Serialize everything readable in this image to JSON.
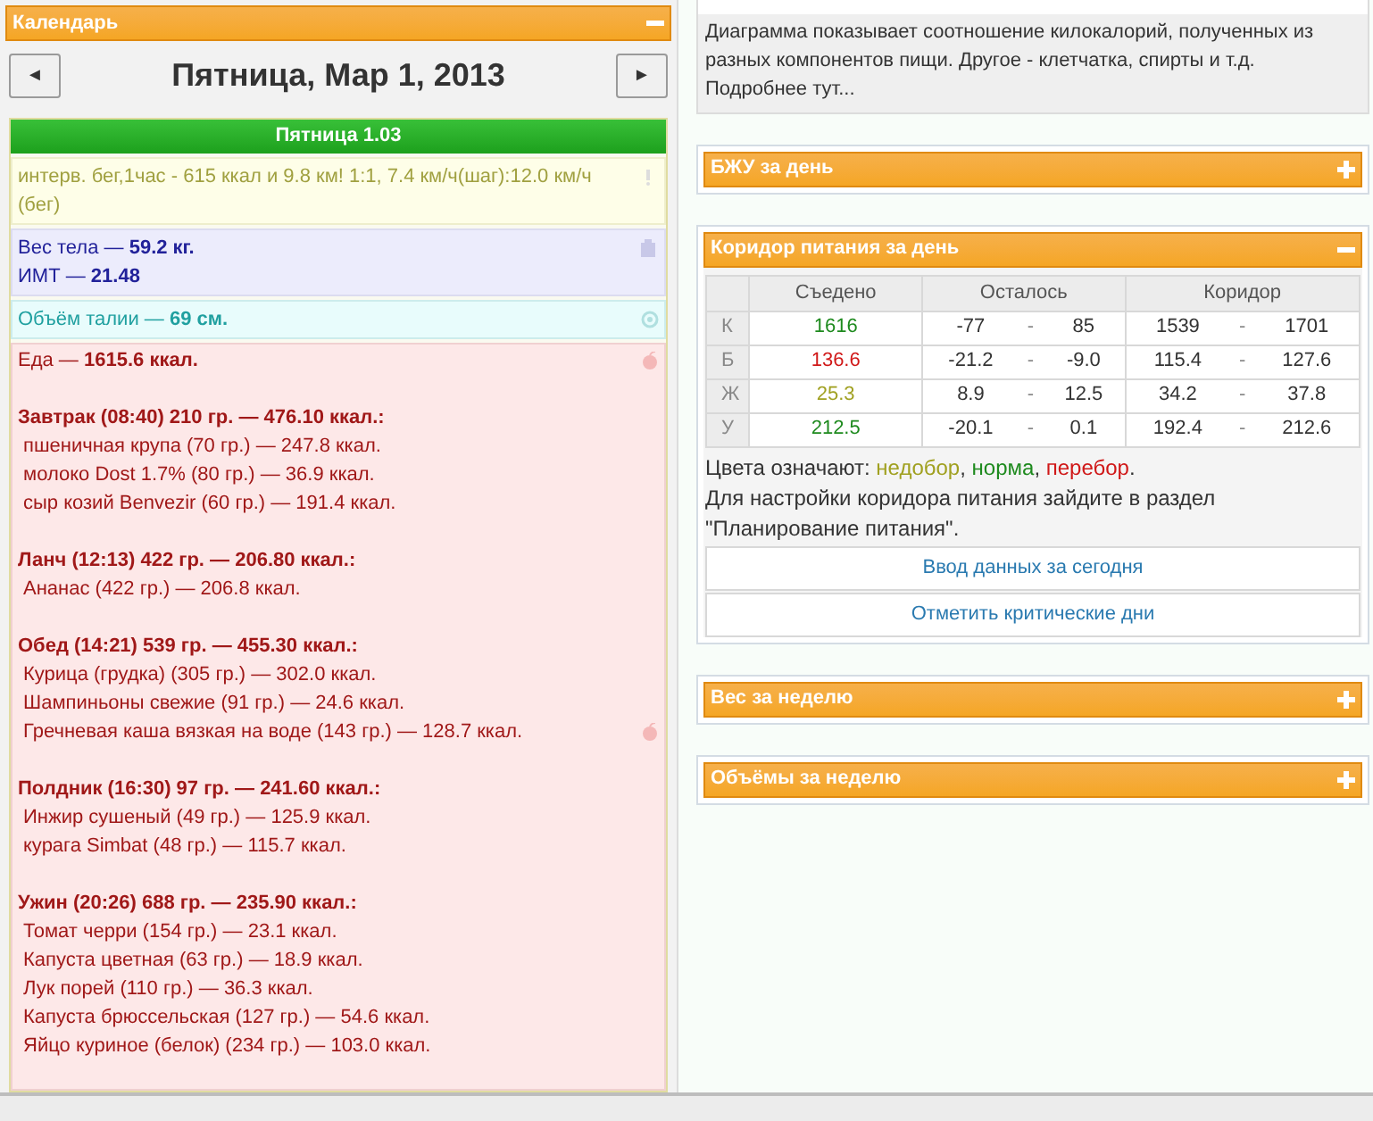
{
  "calendar": {
    "title": "Календарь",
    "expanded": true,
    "date": "Пятница, Мар 1, 2013",
    "prev": "◄",
    "next": "►",
    "day": "Пятница 1.03",
    "entries": [
      {
        "kind": "activity",
        "lines": [
          "интерв. бег,1час - 615 ккал и 9.8 км! 1:1, 7.4 км/ч(шаг):12.0 км/ч (бег)"
        ]
      },
      {
        "kind": "weight",
        "lines": [
          "Вес тела — **59.2 кг.**",
          "ИМТ — **21.48**"
        ]
      },
      {
        "kind": "measure",
        "lines": [
          "Объём талии — **69 см.**"
        ]
      }
    ],
    "food": {
      "total": "Еда — **1615.6 ккал.**",
      "meals": [
        {
          "title": "Завтрак (08:40) 210 гр. — 476.10 ккал.:",
          "items": [
            {
              "text": "пшеничная крупа (70 гр.) — 247.8 ккал.",
              "icon": false
            },
            {
              "text": "молоко Dost 1.7% (80 гр.) — 36.9 ккал.",
              "icon": false
            },
            {
              "text": "сыр козий Benvezir (60 гр.) — 191.4 ккал.",
              "icon": false
            }
          ]
        },
        {
          "title": "Ланч (12:13) 422 гр. — 206.80 ккал.:",
          "items": [
            {
              "text": "Ананас (422 гр.) — 206.8 ккал.",
              "icon": false
            }
          ]
        },
        {
          "title": "Обед (14:21) 539 гр. — 455.30 ккал.:",
          "items": [
            {
              "text": "Курица (грудка) (305 гр.) — 302.0 ккал.",
              "icon": false
            },
            {
              "text": "Шампиньоны свежие (91 гр.) — 24.6 ккал.",
              "icon": false
            },
            {
              "text": "Гречневая каша вязкая на воде (143 гр.) — 128.7 ккал.",
              "icon": true
            }
          ]
        },
        {
          "title": "Полдник (16:30) 97 гр. — 241.60 ккал.:",
          "items": [
            {
              "text": "Инжир сушеный (49 гр.) — 125.9 ккал.",
              "icon": false
            },
            {
              "text": "курага Simbat (48 гр.) — 115.7 ккал.",
              "icon": false
            }
          ]
        },
        {
          "title": "Ужин (20:26) 688 гр. — 235.90 ккал.:",
          "items": [
            {
              "text": "Томат черри (154 гр.) — 23.1 ккал.",
              "icon": false
            },
            {
              "text": "Капуста цветная (63 гр.) — 18.9 ккал.",
              "icon": false
            },
            {
              "text": "Лук порей (110 гр.) — 36.3 ккал.",
              "icon": false
            },
            {
              "text": "Капуста брюссельская (127 гр.) — 54.6 ккал.",
              "icon": false
            },
            {
              "text": "Яйцо куриное (белок) (234 гр.) — 103.0 ккал.",
              "icon": false
            }
          ]
        }
      ]
    }
  },
  "chart_note": "Диаграмма показывает соотношение килокалорий, полученных из разных компонентов пищи. Другое - клетчатка, спирты и т.д.",
  "chart_more": "Подробнее тут...",
  "panels": [
    {
      "title": "БЖУ за день",
      "expanded": false
    },
    {
      "title": "Коридор питания за день",
      "expanded": true,
      "table": {
        "columns": [
          "Съедено",
          "Осталось",
          "Коридор"
        ],
        "rows": [
          {
            "label": "К",
            "eaten": "1616",
            "color": "#1e8a1e",
            "remaining": [
              "-77",
              "-",
              "85"
            ],
            "corridor": [
              "1539",
              "-",
              "1701"
            ]
          },
          {
            "label": "Б",
            "eaten": "136.6",
            "color": "#d01818",
            "remaining": [
              "-21.2",
              "-",
              "-9.0"
            ],
            "corridor": [
              "115.4",
              "-",
              "127.6"
            ]
          },
          {
            "label": "Ж",
            "eaten": "25.3",
            "color": "#a0a020",
            "remaining": [
              "8.9",
              "-",
              "12.5"
            ],
            "corridor": [
              "34.2",
              "-",
              "37.8"
            ]
          },
          {
            "label": "У",
            "eaten": "212.5",
            "color": "#1e8a1e",
            "remaining": [
              "-20.1",
              "-",
              "0.1"
            ],
            "corridor": [
              "192.4",
              "-",
              "212.6"
            ]
          }
        ]
      },
      "legend": [
        {
          "text": "Цвета означают: "
        },
        {
          "text": "недобор",
          "color": "#a0a020"
        },
        {
          "text": ", "
        },
        {
          "text": "норма",
          "color": "#1e8a1e"
        },
        {
          "text": ", "
        },
        {
          "text": "перебор",
          "color": "#d01818"
        },
        {
          "text": "."
        }
      ],
      "note": "Для настройки коридора питания зайдите в раздел \"Планирование питания\".",
      "buttons": [
        "Ввод данных за сегодня",
        "Отметить критические дни"
      ]
    },
    {
      "title": "Вес за неделю",
      "expanded": false
    },
    {
      "title": "Объёмы за неделю",
      "expanded": false
    }
  ]
}
